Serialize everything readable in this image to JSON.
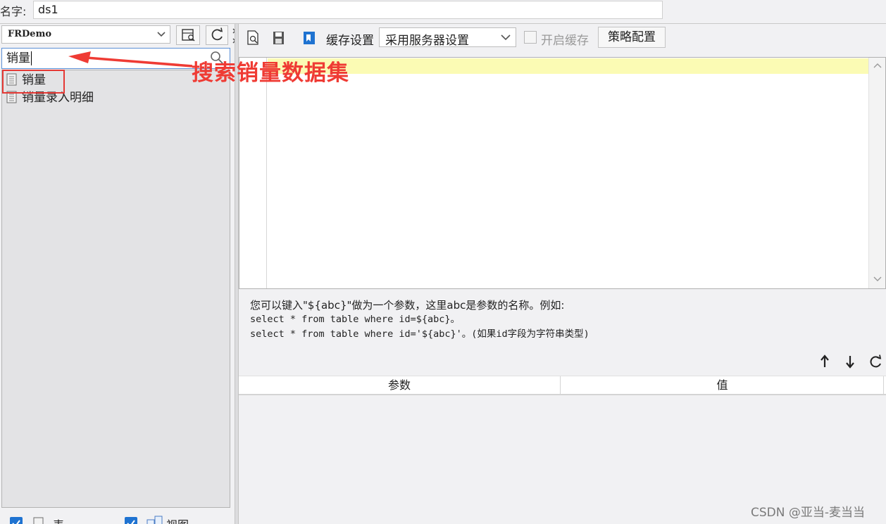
{
  "dataset": {
    "name_label": "名字:",
    "name_value": "ds1"
  },
  "left": {
    "db_select_value": "FRDemo",
    "search_value": "销量",
    "tree_items": [
      "销量",
      "销量录入明细"
    ],
    "bottom_checks": [
      {
        "label": "表",
        "checked": true
      },
      {
        "label": "视图",
        "checked": true
      }
    ]
  },
  "toolbar": {
    "cache_label": "缓存设置",
    "cache_select_value": "采用服务器设置",
    "enable_cache_label": "开启缓存",
    "enable_cache_checked": false,
    "strategy_button_label": "策略配置"
  },
  "hint": {
    "line1": "您可以键入\"${abc}\"做为一个参数，这里abc是参数的名称。例如:",
    "line2": "select * from table where id=${abc}。",
    "line3": "select * from table where id='${abc}'。(如果id字段为字符串类型)"
  },
  "params": {
    "col_name": "参数",
    "col_value": "值"
  },
  "annotation": {
    "text": "搜索销量数据集",
    "color": "#ef3b34"
  },
  "watermark": "CSDN @亚当-麦当当",
  "colors": {
    "accent": "#1f73d1",
    "highlight_line": "#fbfbb4",
    "annotation_red": "#ef3b34"
  }
}
